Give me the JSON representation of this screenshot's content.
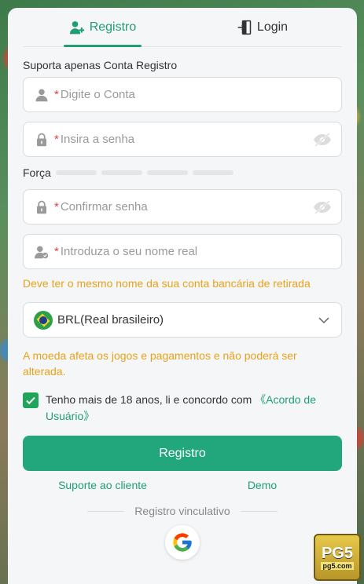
{
  "tabs": [
    {
      "label": "Registro",
      "icon": "user-plus-icon",
      "active": true
    },
    {
      "label": "Login",
      "icon": "login-door-icon",
      "active": false
    }
  ],
  "form": {
    "hint": "Suporta apenas Conta Registro",
    "required_mark": "*",
    "account_placeholder": "Digite o Conta",
    "password_placeholder": "Insira a senha",
    "strength_label": "Força",
    "confirm_placeholder": "Confirmar senha",
    "realname_placeholder": "Introduza o seu nome real",
    "realname_warning": "Deve ter o mesmo nome da sua conta bancária de retirada",
    "currency_value": "BRL(Real brasileiro)",
    "currency_warning": "A moeda afeta os jogos e pagamentos e não poderá ser alterada.",
    "agree_text": "Tenho mais de 18 anos, li e concordo com ",
    "agree_link": "《Acordo de Usuário》",
    "agree_checked": true,
    "submit_label": "Registro"
  },
  "links": {
    "support": "Suporte ao cliente",
    "demo": "Demo"
  },
  "social": {
    "divider_text": "Registro vinculativo",
    "google_icon": "google-icon"
  },
  "badge": {
    "line1": "PG5",
    "line2": "pg5.com"
  },
  "colors": {
    "accent": "#1f9e73",
    "button": "#22a77d",
    "warning": "#e8a21a",
    "required": "#e04040"
  }
}
